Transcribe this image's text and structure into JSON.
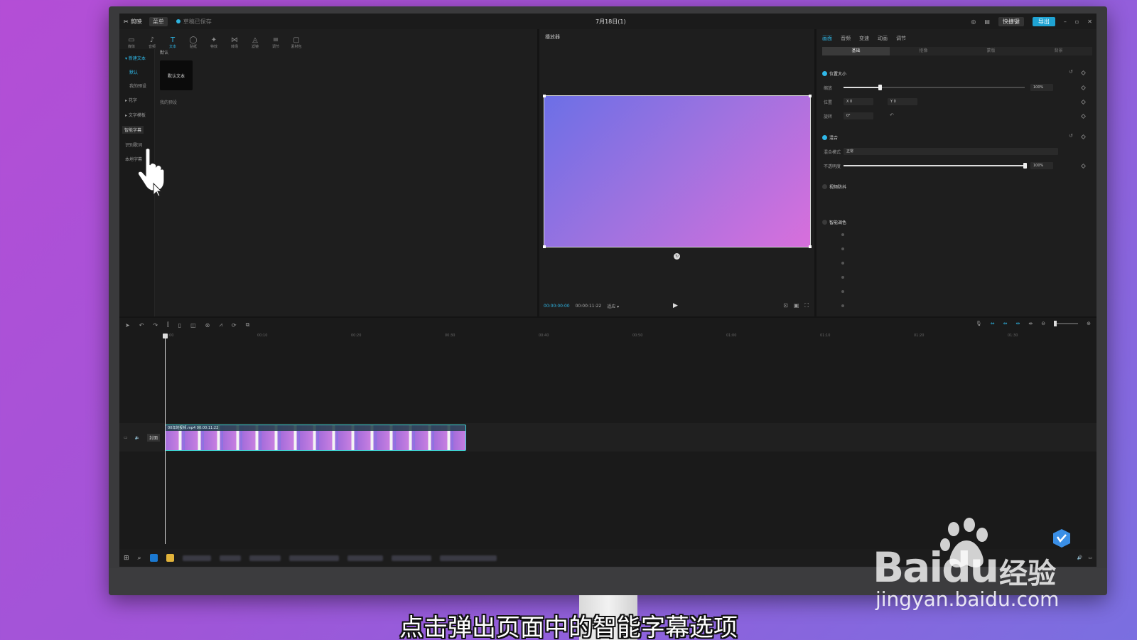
{
  "app": {
    "logo": "剪映",
    "menu_label": "菜单",
    "doc_status": "草稿已保存",
    "project_title": "7月18日(1)",
    "shortcut_label": "快捷键",
    "export_label": "导出"
  },
  "media": {
    "tool_tabs": [
      {
        "icon": "▭",
        "label": "媒体"
      },
      {
        "icon": "♪",
        "label": "音频"
      },
      {
        "icon": "T",
        "label": "文本"
      },
      {
        "icon": "◯",
        "label": "贴纸"
      },
      {
        "icon": "✦",
        "label": "特效"
      },
      {
        "icon": "⋈",
        "label": "转场"
      },
      {
        "icon": "◬",
        "label": "滤镜"
      },
      {
        "icon": "≡",
        "label": "调节"
      },
      {
        "icon": "▢",
        "label": "素材包"
      }
    ],
    "sidebar": [
      {
        "label": "▾ 新建文本"
      },
      {
        "label": "默认"
      },
      {
        "label": "我的预设"
      },
      {
        "label": "▸ 花字"
      },
      {
        "label": "▸ 文字模板"
      },
      {
        "label": "智能字幕"
      },
      {
        "label": "识别歌词"
      },
      {
        "label": "本地字幕"
      }
    ],
    "presets_heading": "默认",
    "preset_tile": "默认文本",
    "my_presets": "我的预设"
  },
  "player": {
    "title": "播放器",
    "time_current": "00:00:00:00",
    "time_total": "00:00:11:22",
    "ratio": "适应 ▾",
    "play": "▶"
  },
  "inspector": {
    "tabs": [
      "画面",
      "音频",
      "变速",
      "动画",
      "调节"
    ],
    "subtabs": [
      "基础",
      "抠像",
      "蒙版",
      "背景"
    ],
    "position_size": "位置大小",
    "scale_label": "缩放",
    "scale_value": "100%",
    "scale_fraction": 0.2,
    "position_label": "位置",
    "pos_x": "X  0",
    "pos_y": "Y  0",
    "rotate_label": "旋转",
    "rotate_value": "0°",
    "blend": "混合",
    "blend_mode_label": "混合模式",
    "blend_mode_value": "正常",
    "opacity_label": "不透明度",
    "opacity_value": "100%",
    "opacity_fraction": 1.0,
    "stabilize": "视频防抖",
    "color_correct": "智能调色"
  },
  "timeline": {
    "ticks": [
      "00:00",
      "00:10",
      "00:20",
      "00:30",
      "00:40",
      "00:50",
      "01:00",
      "01:10",
      "01:20",
      "01:30"
    ],
    "cover_tag": "封面",
    "clip_label": "00年的视频.mp4  00:00:11:22"
  },
  "subtitle": "点击弹出页面中的智能字幕选项",
  "watermark": {
    "brand": "Bai",
    "du": "du",
    "cn": "经验",
    "url": "jingyan.baidu.com"
  },
  "colors": {
    "accent": "#2fb8e8",
    "background_gradient": [
      "#b44ed6",
      "#7a6fe0"
    ],
    "preview_gradient": [
      "#6c6fe6",
      "#d86fdc"
    ]
  }
}
